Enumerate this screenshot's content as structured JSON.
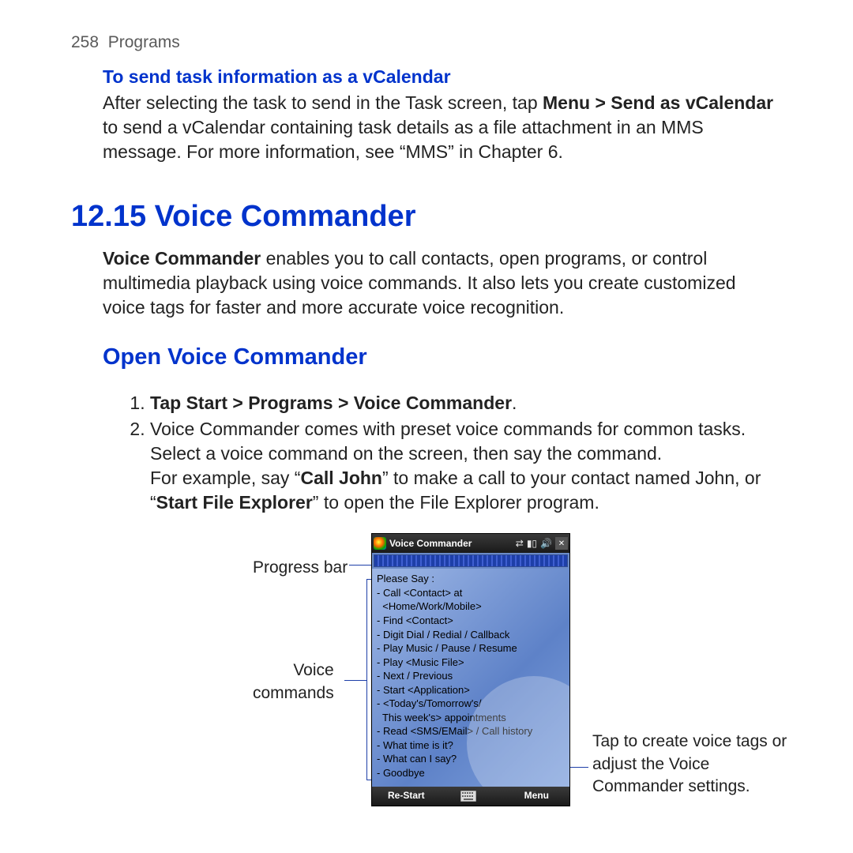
{
  "header": {
    "page_number": "258",
    "section": "Programs"
  },
  "sub1": {
    "title": "To send task information as a vCalendar",
    "p_before": "After selecting the task to send in the Task screen, tap ",
    "p_bold": "Menu > Send as vCalendar",
    "p_after": " to send a vCalendar containing task details as a file attachment in an MMS message. For more information, see “MMS” in Chapter 6."
  },
  "h1": "12.15  Voice Commander",
  "intro": {
    "bold": "Voice Commander",
    "rest": " enables you to call contacts, open programs, or control multimedia playback using voice commands. It also lets you create customized voice tags for faster and more accurate voice recognition."
  },
  "h2": "Open Voice Commander",
  "steps": {
    "s1_pre": "Tap ",
    "s1_bold": "Start > Programs > Voice Commander",
    "s1_post": ".",
    "s2a": "Voice Commander comes with preset voice commands for common tasks. Select a voice command on the screen, then say the command.",
    "s2b_pre": "For example, say “",
    "s2b_b1": "Call John",
    "s2b_mid": "” to make a call to your contact named John, or “",
    "s2b_b2": "Start File Explorer",
    "s2b_post": "” to open the File Explorer program."
  },
  "callouts": {
    "progress": "Progress bar",
    "commands_l1": "Voice",
    "commands_l2": "commands",
    "menu": "Tap to create voice tags or adjust the Voice Commander settings."
  },
  "device": {
    "title": "Voice Commander",
    "prompt": "Please Say :",
    "lines": [
      "- Call <Contact> at",
      "  <Home/Work/Mobile>",
      "- Find <Contact>",
      "- Digit Dial / Redial / Callback",
      "- Play Music / Pause / Resume",
      "- Play <Music File>",
      "- Next / Previous",
      "- Start <Application>",
      "- <Today's/Tomorrow's/",
      "  This week's> appointments",
      "- Read <SMS/EMail> / Call history",
      "- What time is it?",
      "- What can I say?",
      "- Goodbye"
    ],
    "restart": "Re-Start",
    "menu": "Menu"
  }
}
